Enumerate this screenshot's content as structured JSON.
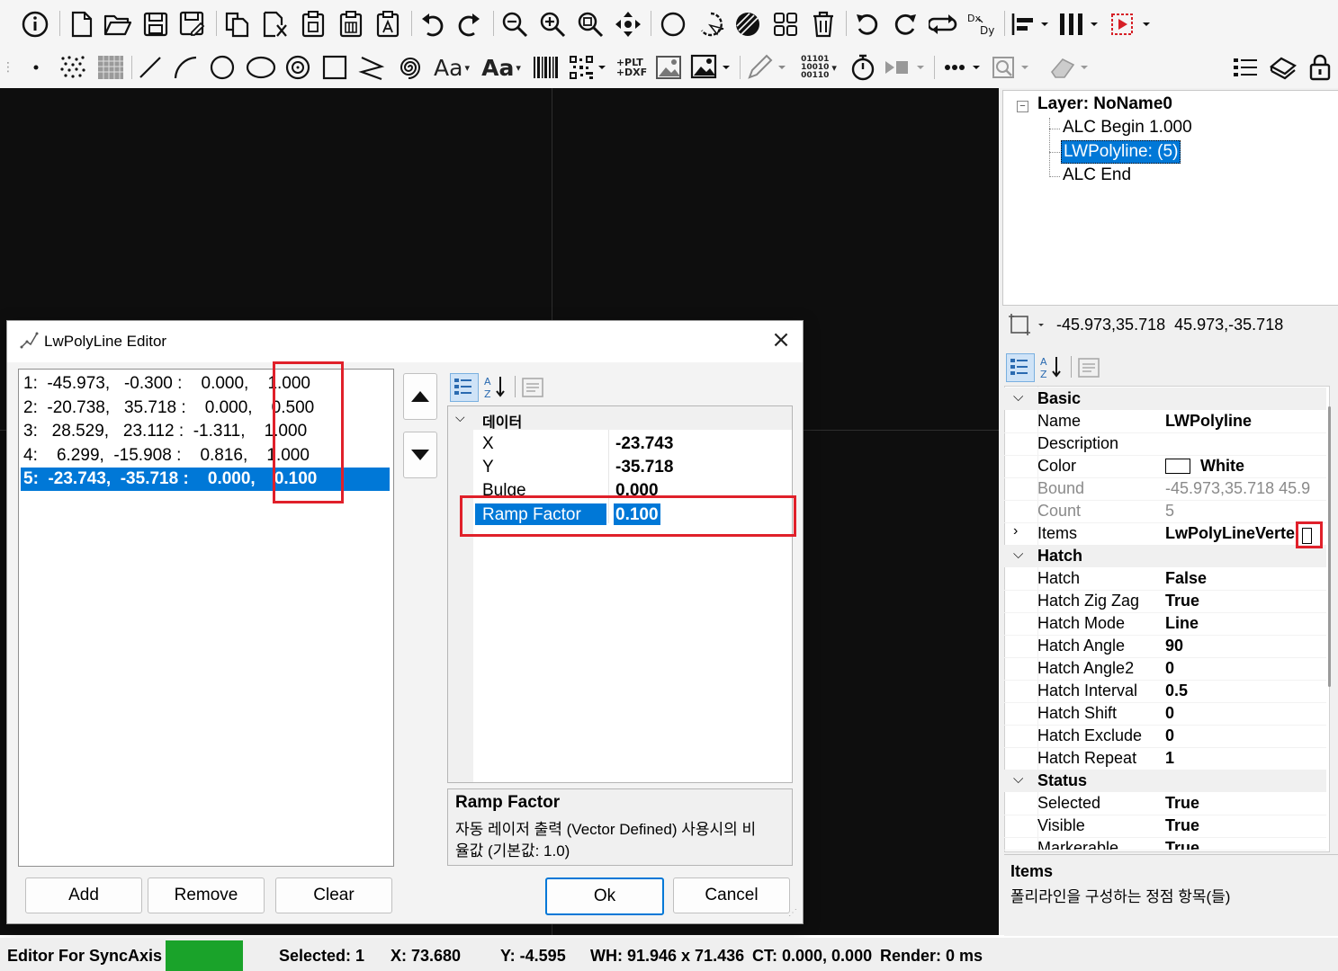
{
  "toolbar_top": {
    "icons": [
      "info-icon",
      "new-file-icon",
      "open-folder-icon",
      "save-icon",
      "save-as-icon",
      "copy-icon",
      "cut-icon",
      "paste-icon",
      "paste-array-icon",
      "paste-text-icon",
      "undo-icon",
      "redo-icon",
      "zoom-out-icon",
      "zoom-in-icon",
      "zoom-fit-icon",
      "pan-icon",
      "circle-select-icon",
      "lasso-select-icon",
      "hatch-icon",
      "group-icon",
      "delete-icon",
      "rotate-ccw-icon",
      "rotate-cw-icon",
      "mirror-icon",
      "dx-dy-icon",
      "align-icon",
      "distribute-icon",
      "execute-icon"
    ]
  },
  "toolbar_draw": {
    "text_tool_label": "Aa",
    "text_tool_bold_label": "Aa",
    "plt_dxf_label": "+PLT\n+DXF",
    "binary_label": "01101\n10010\n00110",
    "icons": [
      "point-icon",
      "point-cloud-icon",
      "raster-icon",
      "line-icon",
      "arc-icon",
      "circle-icon",
      "ellipse-icon",
      "spiral-circle-icon",
      "rectangle-icon",
      "polyline-icon",
      "spiral-icon",
      "barcode-icon",
      "qrcode-icon",
      "image-icon",
      "image-edit-icon",
      "pen-icon",
      "timer-icon",
      "motion-icon",
      "more-icon",
      "zoom-select-icon",
      "eraser-icon",
      "list-icon",
      "layers-icon",
      "lock-icon"
    ]
  },
  "tree": {
    "layer": "Layer: NoName0",
    "items": [
      "ALC Begin 1.000",
      "LWPolyline: (5)",
      "ALC End"
    ],
    "selected_index": 1
  },
  "bounds_readout": "-45.973,35.718  45.973,-35.718",
  "properties": {
    "categories": [
      "Basic",
      "Hatch",
      "Status"
    ],
    "basic": [
      {
        "name": "Name",
        "value": "LWPolyline"
      },
      {
        "name": "Description",
        "value": ""
      },
      {
        "name": "Color",
        "value": "White"
      },
      {
        "name": "Bound",
        "value": "-45.973,35.718  45.9"
      },
      {
        "name": "Count",
        "value": "5"
      },
      {
        "name": "Items",
        "value": "LwPolyLineVerte"
      }
    ],
    "hatch": [
      {
        "name": "Hatch",
        "value": "False"
      },
      {
        "name": "Hatch Zig Zag",
        "value": "True"
      },
      {
        "name": "Hatch Mode",
        "value": "Line"
      },
      {
        "name": "Hatch Angle",
        "value": "90"
      },
      {
        "name": "Hatch Angle2",
        "value": "0"
      },
      {
        "name": "Hatch Interval",
        "value": "0.5"
      },
      {
        "name": "Hatch Shift",
        "value": "0"
      },
      {
        "name": "Hatch Exclude",
        "value": "0"
      },
      {
        "name": "Hatch Repeat",
        "value": "1"
      }
    ],
    "status": [
      {
        "name": "Selected",
        "value": "True"
      },
      {
        "name": "Visible",
        "value": "True"
      },
      {
        "name": "Markerable",
        "value": "True"
      }
    ],
    "help_title": "Items",
    "help_text": "폴리라인을 구성하는 정점 항목(들)"
  },
  "dialog": {
    "title": "LwPolyLine Editor",
    "vertices": [
      "1:  -45.973,   -0.300 :    0.000,    1.000",
      "2:  -20.738,   35.718 :    0.000,    0.500",
      "3:   28.529,   23.112 :  -1.311,    1.000",
      "4:    6.299,  -15.908 :    0.816,    1.000",
      "5:  -23.743,  -35.718 :    0.000,    0.100"
    ],
    "selected_vertex": 4,
    "grid_category": "데이터",
    "grid_rows": [
      {
        "name": "X",
        "value": "-23.743"
      },
      {
        "name": "Y",
        "value": "-35.718"
      },
      {
        "name": "Bulge",
        "value": "0.000"
      },
      {
        "name": "Ramp Factor",
        "value": "0.100"
      }
    ],
    "help_title": "Ramp Factor",
    "help_text_1": "자동 레이저 출력 (Vector Defined) 사용시의 비",
    "help_text_2": "율값 (기본값: 1.0)",
    "buttons": {
      "add": "Add",
      "remove": "Remove",
      "clear": "Clear",
      "ok": "Ok",
      "cancel": "Cancel"
    }
  },
  "statusbar": {
    "mode": "Editor For SyncAxis",
    "selected": "Selected: 1",
    "x": "X: 73.680",
    "y": "Y: -4.595",
    "wh": "WH: 91.946 x 71.436",
    "ct": "CT: 0.000, 0.000",
    "render": "Render: 0 ms",
    "status_color": "#1aa32a"
  },
  "colors": {
    "selection": "#0078d7",
    "highlight_box": "#e0202a"
  }
}
